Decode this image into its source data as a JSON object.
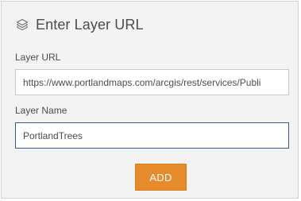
{
  "header": {
    "icon": "layers-icon",
    "title": "Enter Layer URL"
  },
  "form": {
    "url_label": "Layer URL",
    "url_value": "https://www.portlandmaps.com/arcgis/rest/services/Publi",
    "name_label": "Layer Name",
    "name_value": "PortlandTrees",
    "add_label": "ADD"
  },
  "colors": {
    "panel_bg": "#f3f3f3",
    "accent": "#e68b2c",
    "focus_border": "#3b5988",
    "text": "#4c4c4c"
  }
}
